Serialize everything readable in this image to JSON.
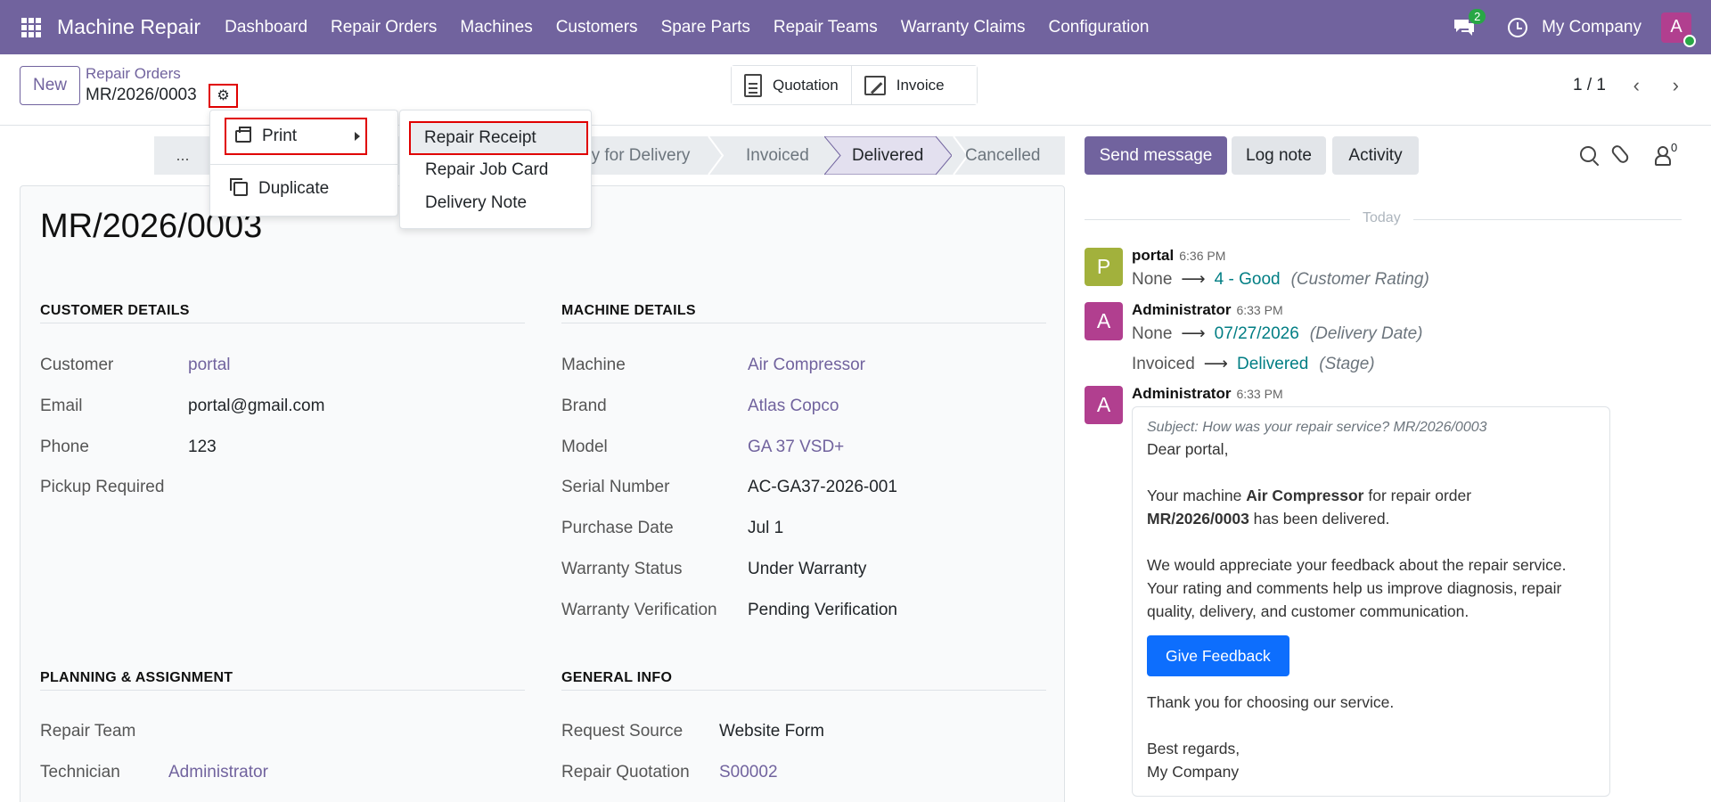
{
  "navbar": {
    "brand": "Machine Repair",
    "menu": [
      "Dashboard",
      "Repair Orders",
      "Machines",
      "Customers",
      "Spare Parts",
      "Repair Teams",
      "Warranty Claims",
      "Configuration"
    ],
    "chat_count": "2",
    "company": "My Company",
    "avatar_letter": "A"
  },
  "control": {
    "new_label": "New",
    "breadcrumb": "Repair Orders",
    "record": "MR/2026/0003",
    "smart_quotation": "Quotation",
    "smart_invoice": "Invoice",
    "pager": "1 / 1"
  },
  "statusbar": {
    "more": "...",
    "stages": [
      "dy for Delivery",
      "Invoiced",
      "Delivered",
      "Cancelled"
    ],
    "active": "Delivered"
  },
  "gear_menu": {
    "print": "Print",
    "duplicate": "Duplicate",
    "print_items": [
      "Repair Receipt",
      "Repair Job Card",
      "Delivery Note"
    ]
  },
  "form": {
    "title": "MR/2026/0003",
    "customer_details": {
      "heading": "CUSTOMER DETAILS",
      "fields": [
        {
          "label": "Customer",
          "value": "portal"
        },
        {
          "label": "Email",
          "value": "portal@gmail.com"
        },
        {
          "label": "Phone",
          "value": "123"
        },
        {
          "label": "Pickup Required",
          "value": ""
        }
      ]
    },
    "machine_details": {
      "heading": "MACHINE DETAILS",
      "fields": [
        {
          "label": "Machine",
          "value": "Air Compressor"
        },
        {
          "label": "Brand",
          "value": "Atlas Copco"
        },
        {
          "label": "Model",
          "value": "GA 37 VSD+"
        },
        {
          "label": "Serial Number",
          "value": "AC-GA37-2026-001"
        },
        {
          "label": "Purchase Date",
          "value": "Jul 1"
        },
        {
          "label": "Warranty Status",
          "value": "Under Warranty"
        },
        {
          "label": "Warranty Verification",
          "value": "Pending Verification"
        }
      ]
    },
    "planning": {
      "heading": "PLANNING & ASSIGNMENT",
      "fields": [
        {
          "label": "Repair Team",
          "value": ""
        },
        {
          "label": "Technician",
          "value": "Administrator"
        }
      ]
    },
    "general": {
      "heading": "GENERAL INFO",
      "fields": [
        {
          "label": "Request Source",
          "value": "Website Form"
        },
        {
          "label": "Repair Quotation",
          "value": "S00002"
        }
      ]
    }
  },
  "chatter": {
    "send_message": "Send message",
    "log_note": "Log note",
    "activity": "Activity",
    "followers": "0",
    "today": "Today",
    "messages": [
      {
        "avatar": "P",
        "color": "#a2b13c",
        "author": "portal",
        "time": "6:36 PM",
        "old": "None",
        "new": "4 - Good",
        "field": "(Customer Rating)"
      },
      {
        "avatar": "A",
        "color": "#b13f8f",
        "author": "Administrator",
        "time": "6:33 PM",
        "old": "None",
        "new": "07/27/2026",
        "field": "(Delivery Date)",
        "old2": "Invoiced",
        "new2": "Delivered",
        "field2": "(Stage)"
      },
      {
        "avatar": "A",
        "color": "#b13f8f",
        "author": "Administrator",
        "time": "6:33 PM"
      }
    ],
    "mail": {
      "subject": "Subject: How was your repair service? MR/2026/0003",
      "greeting": "Dear portal,",
      "p1_a": "Your machine ",
      "p1_machine": "Air Compressor",
      "p1_b": " for repair order",
      "p1_order": "MR/2026/0003",
      "p1_c": " has been delivered.",
      "p2": "We would appreciate your feedback about the repair service. Your rating and comments help us improve diagnosis, repair quality, delivery, and customer communication.",
      "button": "Give Feedback",
      "thanks": "Thank you for choosing our service.",
      "regards": "Best regards,",
      "signature": "My Company"
    }
  }
}
